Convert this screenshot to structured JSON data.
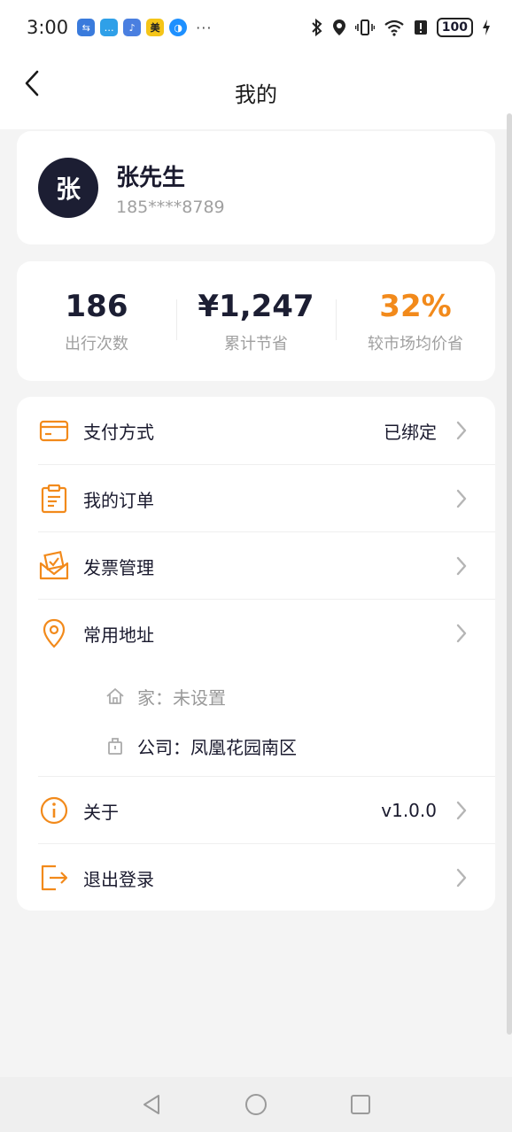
{
  "status": {
    "time": "3:00",
    "apps": [
      {
        "name": "usb-app",
        "color": "#3a7bdc",
        "glyph": "⇆"
      },
      {
        "name": "message-app",
        "color": "#2fa0e8",
        "glyph": "…"
      },
      {
        "name": "music-app",
        "color": "#4a7fe0",
        "glyph": "♪"
      },
      {
        "name": "meituan-app",
        "color": "#f5c518",
        "glyph": "美"
      },
      {
        "name": "browser-app",
        "color": "#1e90ff",
        "glyph": "◑"
      }
    ],
    "dots": "···",
    "battery": "100"
  },
  "navbar": {
    "title": "我的"
  },
  "profile": {
    "avatar_text": "张",
    "name": "张先生",
    "phone": "185****8789"
  },
  "stats": [
    {
      "value": "186",
      "label": "出行次数"
    },
    {
      "value": "¥1,247",
      "label": "累计节省"
    },
    {
      "value": "32%",
      "label": "较市场均价省"
    }
  ],
  "menu": {
    "payment": {
      "label": "支付方式",
      "value": "已绑定"
    },
    "orders": {
      "label": "我的订单"
    },
    "invoice": {
      "label": "发票管理"
    },
    "address": {
      "label": "常用地址"
    },
    "home": {
      "key": "家：",
      "value": "未设置"
    },
    "company": {
      "key": "公司：",
      "value": "凤凰花园南区"
    },
    "about": {
      "label": "关于",
      "value": "v1.0.0"
    },
    "logout": {
      "label": "退出登录"
    }
  },
  "colors": {
    "accent": "#f28a1b",
    "dark": "#1c1e33"
  }
}
